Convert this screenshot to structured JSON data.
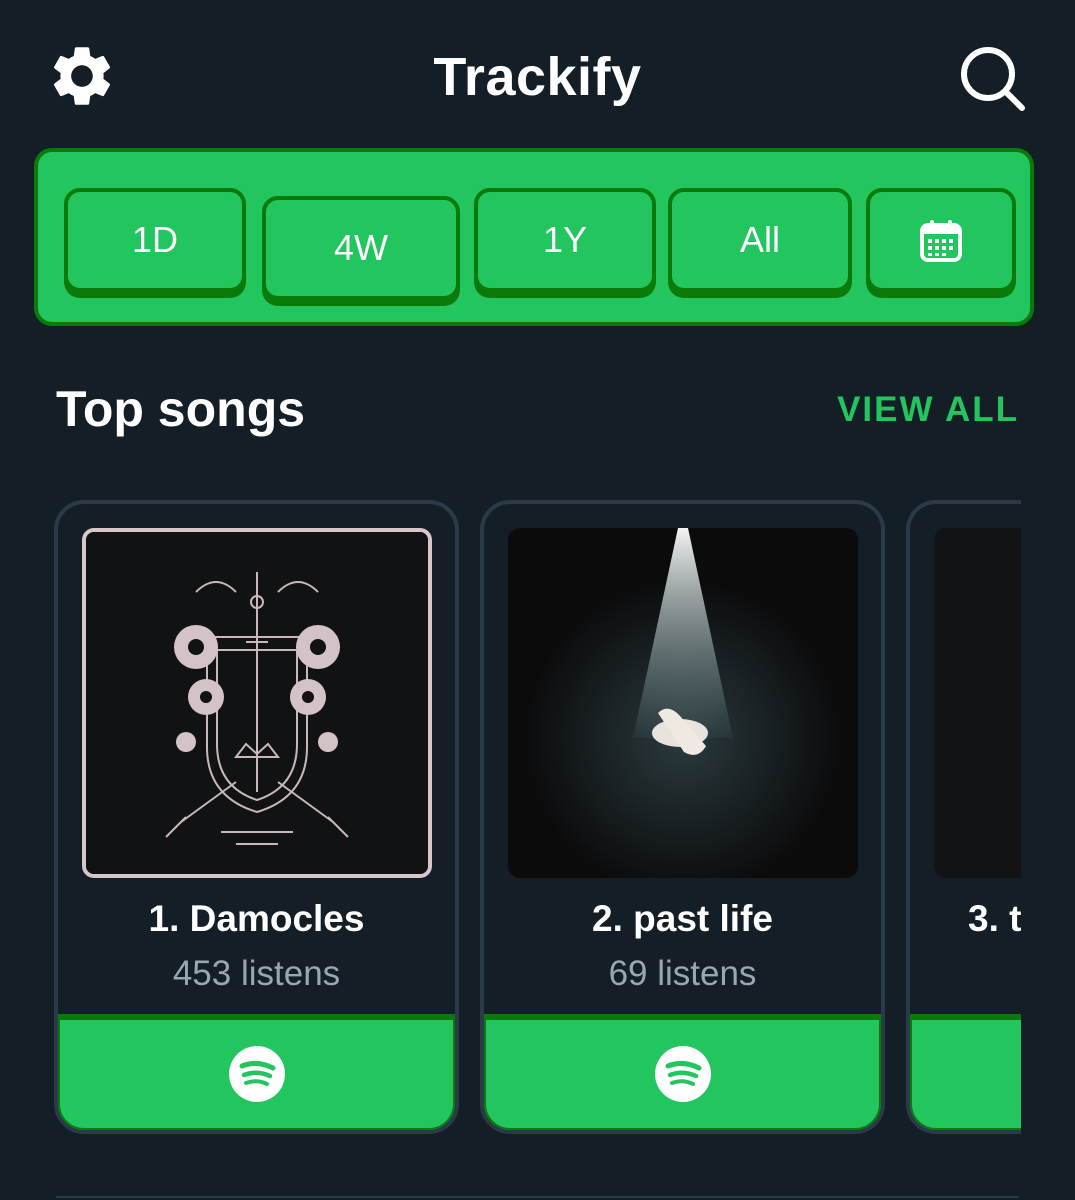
{
  "app": {
    "title": "Trackify"
  },
  "header": {
    "settings_icon": "gear-icon",
    "search_icon": "search-icon"
  },
  "range_selector": {
    "options": [
      {
        "label": "1D"
      },
      {
        "label": "4W"
      },
      {
        "label": "1Y"
      },
      {
        "label": "All"
      },
      {
        "label": "",
        "icon": "calendar-icon"
      }
    ]
  },
  "top_songs": {
    "title": "Top songs",
    "view_all_label": "VIEW ALL",
    "items": [
      {
        "title": "1. Damocles",
        "listens": "453 listens",
        "art": "ornate-crest-artwork",
        "button_icon": "spotify-icon"
      },
      {
        "title": "2. past life",
        "listens": "69 listens",
        "art": "spotlight-figure-artwork",
        "button_icon": "spotify-icon"
      },
      {
        "title": "3. t",
        "listens": "",
        "art": "dark-artwork",
        "button_icon": "spotify-icon"
      }
    ]
  },
  "colors": {
    "background": "#141e26",
    "accent": "#22c55e",
    "accent_dark": "#0b7a0b",
    "muted_text": "#9aa6b2",
    "card_border": "#2b3a48"
  }
}
